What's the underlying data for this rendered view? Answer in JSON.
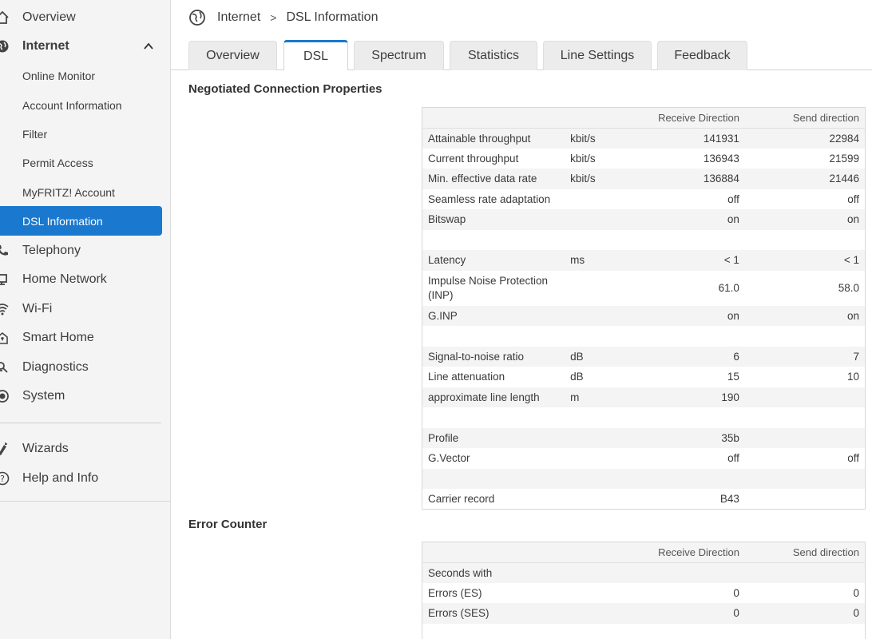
{
  "sidebar": {
    "items": [
      {
        "label": "Overview",
        "icon": "home-icon"
      },
      {
        "label": "Internet",
        "icon": "globe-icon"
      },
      {
        "label": "Telephony",
        "icon": "phone-icon"
      },
      {
        "label": "Home Network",
        "icon": "network-icon"
      },
      {
        "label": "Wi-Fi",
        "icon": "wifi-icon"
      },
      {
        "label": "Smart Home",
        "icon": "smart-home-icon"
      },
      {
        "label": "Diagnostics",
        "icon": "diagnostics-icon"
      },
      {
        "label": "System",
        "icon": "system-icon"
      },
      {
        "label": "Wizards",
        "icon": "wizard-icon"
      },
      {
        "label": "Help and Info",
        "icon": "help-icon"
      }
    ],
    "internet_sub": [
      {
        "label": "Online Monitor"
      },
      {
        "label": "Account Information"
      },
      {
        "label": "Filter"
      },
      {
        "label": "Permit Access"
      },
      {
        "label": "MyFRITZ! Account"
      },
      {
        "label": "DSL Information"
      }
    ],
    "accent_color": "#1a78cf"
  },
  "breadcrumb": {
    "parent": "Internet",
    "separator": ">",
    "current": "DSL Information"
  },
  "tabs": [
    {
      "label": "Overview"
    },
    {
      "label": "DSL"
    },
    {
      "label": "Spectrum"
    },
    {
      "label": "Statistics"
    },
    {
      "label": "Line Settings"
    },
    {
      "label": "Feedback"
    }
  ],
  "negotiated": {
    "title": "Negotiated Connection Properties",
    "columns": {
      "rx": "Receive Direction",
      "tx": "Send direction"
    },
    "rows": [
      {
        "label": "Attainable throughput",
        "unit": "kbit/s",
        "rx": "141931",
        "tx": "22984"
      },
      {
        "label": "Current throughput",
        "unit": "kbit/s",
        "rx": "136943",
        "tx": "21599"
      },
      {
        "label": "Min. effective data rate",
        "unit": "kbit/s",
        "rx": "136884",
        "tx": "21446"
      },
      {
        "label": "Seamless rate adaptation",
        "unit": "",
        "rx": "off",
        "tx": "off"
      },
      {
        "label": "Bitswap",
        "unit": "",
        "rx": "on",
        "tx": "on"
      },
      {
        "label": "",
        "unit": "",
        "rx": "",
        "tx": ""
      },
      {
        "label": "Latency",
        "unit": "ms",
        "rx": "< 1",
        "tx": "< 1"
      },
      {
        "label": "Impulse Noise Protection (INP)",
        "unit": "",
        "rx": "61.0",
        "tx": "58.0"
      },
      {
        "label": "G.INP",
        "unit": "",
        "rx": "on",
        "tx": "on"
      },
      {
        "label": "",
        "unit": "",
        "rx": "",
        "tx": ""
      },
      {
        "label": "Signal-to-noise ratio",
        "unit": "dB",
        "rx": "6",
        "tx": "7"
      },
      {
        "label": "Line attenuation",
        "unit": "dB",
        "rx": "15",
        "tx": "10"
      },
      {
        "label": "approximate line length",
        "unit": "m",
        "rx": "190",
        "tx": ""
      },
      {
        "label": "",
        "unit": "",
        "rx": "",
        "tx": ""
      },
      {
        "label": "Profile",
        "unit": "",
        "rx": "35b",
        "tx": ""
      },
      {
        "label": "G.Vector",
        "unit": "",
        "rx": "off",
        "tx": "off"
      },
      {
        "label": "",
        "unit": "",
        "rx": "",
        "tx": ""
      },
      {
        "label": "Carrier record",
        "unit": "",
        "rx": "B43",
        "tx": ""
      }
    ]
  },
  "errors": {
    "title": "Error Counter",
    "columns": {
      "rx": "Receive Direction",
      "tx": "Send direction"
    },
    "rows": [
      {
        "label": "Seconds with",
        "unit": "",
        "rx": "",
        "tx": ""
      },
      {
        "label": "Errors (ES)",
        "unit": "",
        "rx": "0",
        "tx": "0"
      },
      {
        "label": "Errors (SES)",
        "unit": "",
        "rx": "0",
        "tx": "0"
      },
      {
        "label": "",
        "unit": "",
        "rx": "",
        "tx": ""
      }
    ]
  }
}
